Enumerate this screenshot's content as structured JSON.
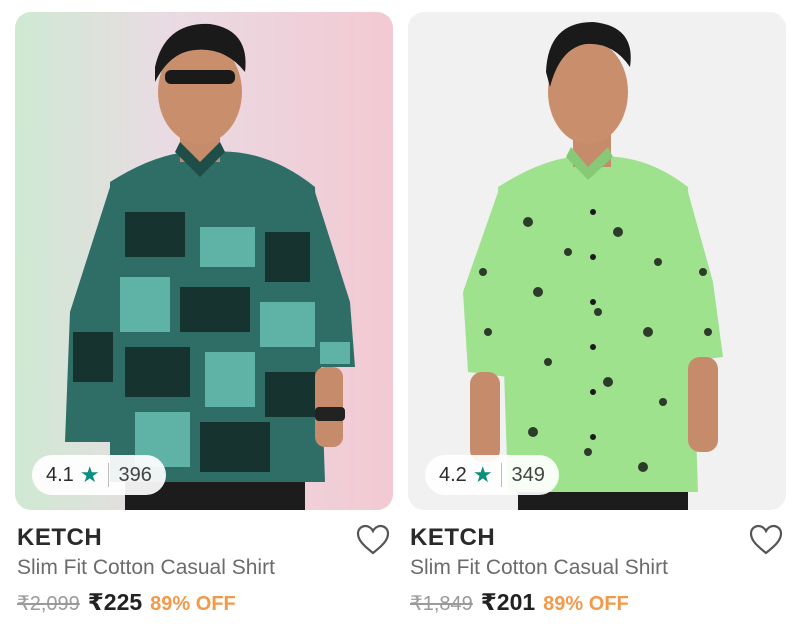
{
  "products": [
    {
      "rating": "4.1",
      "review_count": "396",
      "brand": "KETCH",
      "title": "Slim Fit Cotton Casual Shirt",
      "mrp": "₹2,099",
      "price": "₹225",
      "discount": "89% OFF",
      "image_icon": "model-wearing-teal-printed-shirt"
    },
    {
      "rating": "4.2",
      "review_count": "349",
      "brand": "KETCH",
      "title": "Slim Fit Cotton Casual Shirt",
      "mrp": "₹1,849",
      "price": "₹201",
      "discount": "89% OFF",
      "image_icon": "model-wearing-green-floral-shirt"
    }
  ],
  "colors": {
    "star": "#0c8f7c",
    "discount": "#f2994a"
  }
}
